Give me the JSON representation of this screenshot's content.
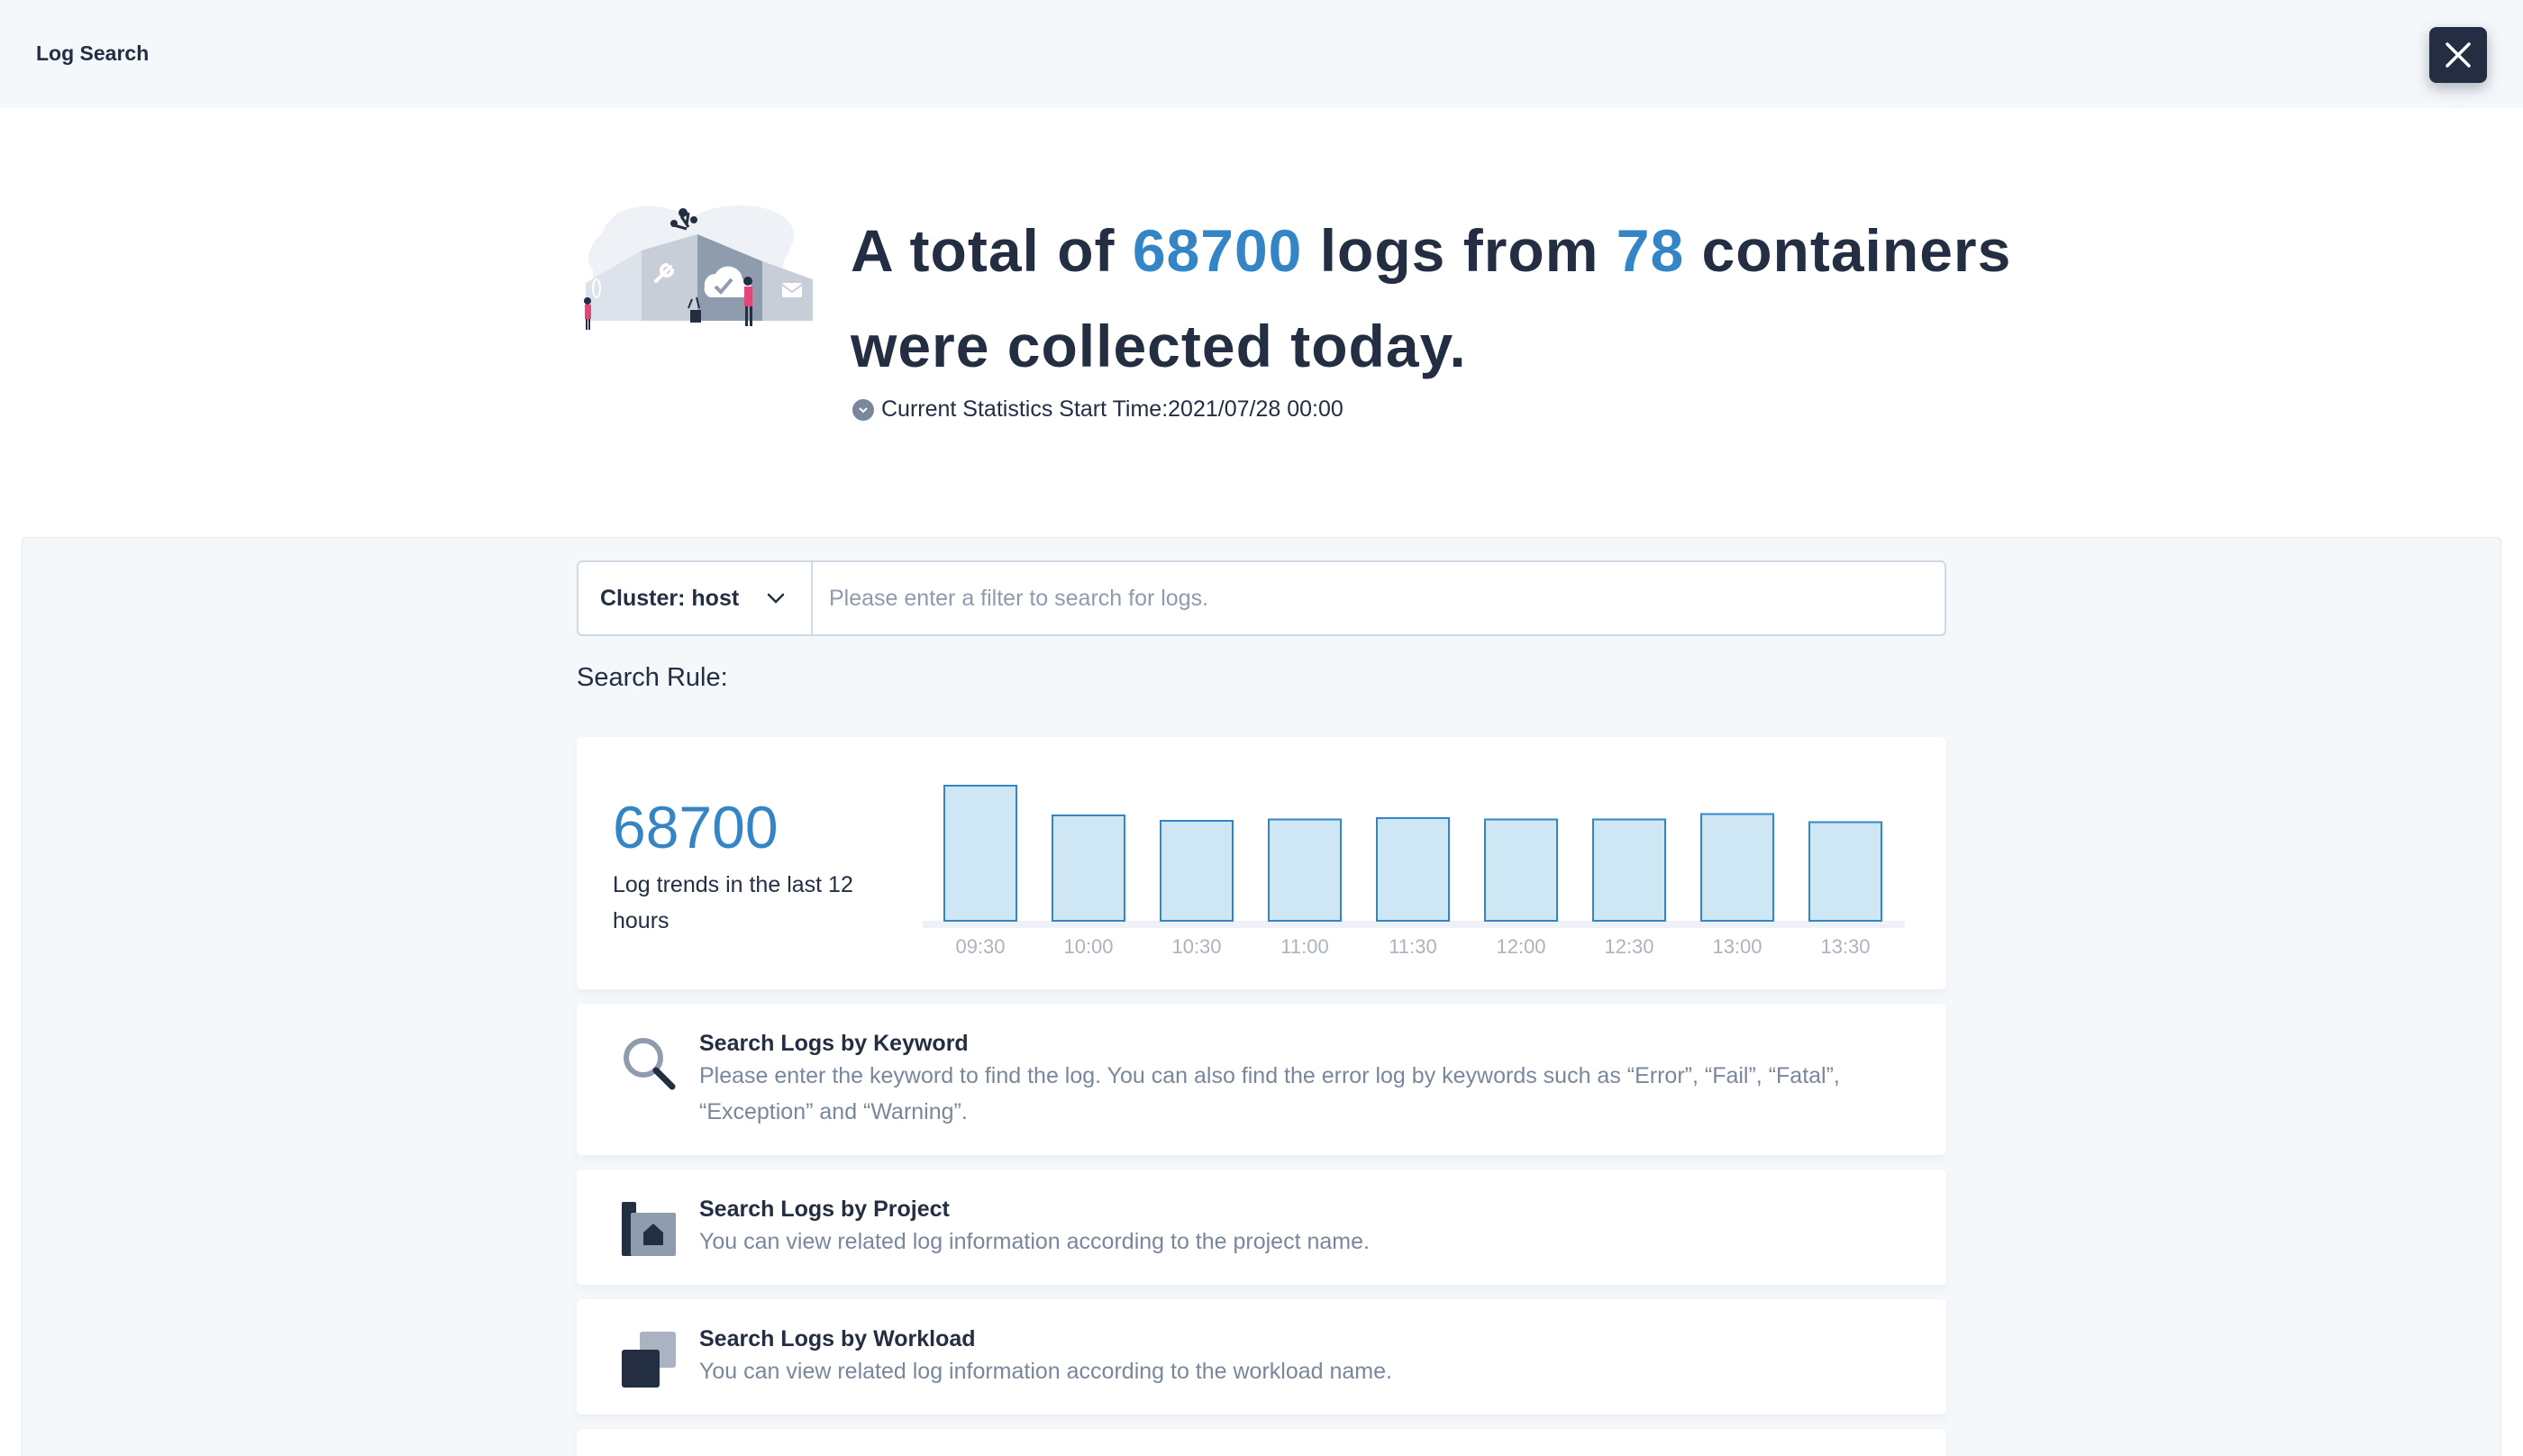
{
  "header": {
    "title": "Log Search"
  },
  "hero": {
    "prefix": "A total of",
    "log_count": "68700",
    "middle": "logs from",
    "container_count": "78",
    "suffix": "containers were collected today.",
    "stat_time": "Current Statistics Start Time:2021/07/28 00:00"
  },
  "search": {
    "cluster_label": "Cluster: host",
    "placeholder": "Please enter a filter to search for logs."
  },
  "rules": {
    "title": "Search Rule:",
    "items": [
      {
        "title": "Search Logs by Keyword",
        "desc": "Please enter the keyword to find the log. You can also find the error log by keywords such as “Error”, “Fail”, “Fatal”, “Exception” and “Warning”.",
        "icon": "search-icon"
      },
      {
        "title": "Search Logs by Project",
        "desc": "You can view related log information according to the project name.",
        "icon": "project-icon"
      },
      {
        "title": "Search Logs by Workload",
        "desc": "You can view related log information according to the workload name.",
        "icon": "workload-icon"
      }
    ]
  },
  "trend": {
    "total": "68700",
    "desc": "Log trends in the last 12 hours"
  },
  "chart_data": {
    "type": "bar",
    "categories": [
      "09:30",
      "10:00",
      "10:30",
      "11:00",
      "11:30",
      "12:00",
      "12:30",
      "13:00",
      "13:30"
    ],
    "values": [
      100,
      78,
      74,
      75,
      76,
      75,
      75,
      79,
      73
    ],
    "title": "",
    "xlabel": "",
    "ylabel": "",
    "ylim": [
      0,
      100
    ],
    "grid": false,
    "bar_fill": "#cfe6f5",
    "bar_stroke": "#3385c6"
  },
  "colors": {
    "accent": "#3385c6",
    "dark": "#242e42",
    "muted": "#79879c"
  }
}
